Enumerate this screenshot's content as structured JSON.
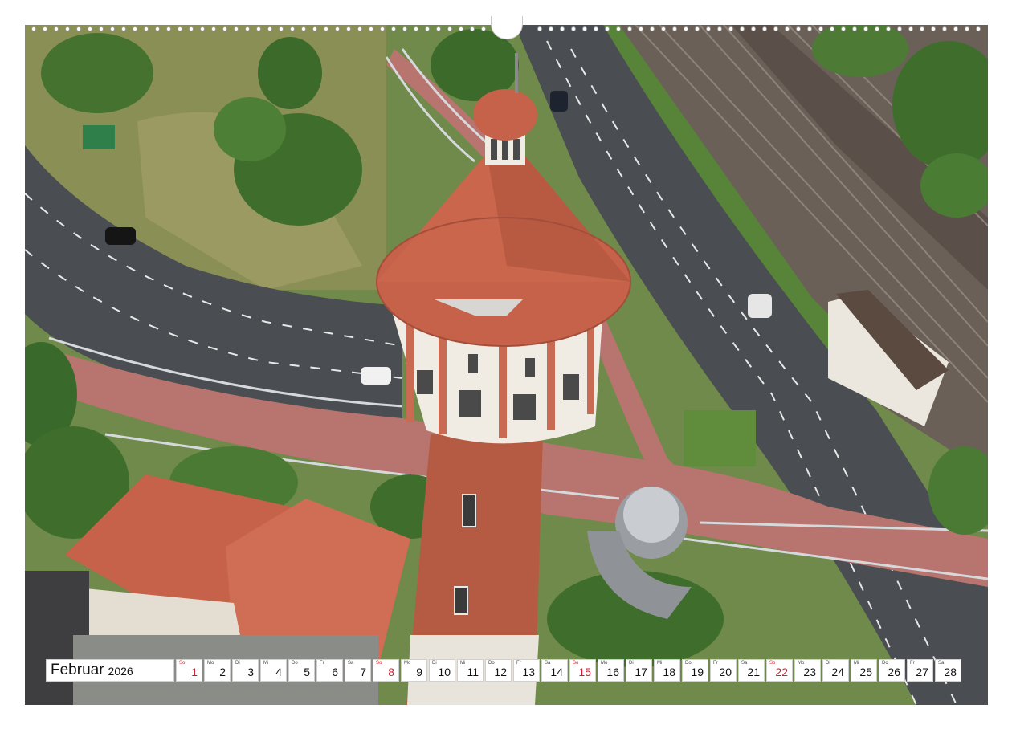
{
  "photo": {
    "subject": "water-tower",
    "colors": {
      "road": "#4a4d51",
      "cycle_path": "#b8746e",
      "roof": "#c6614a",
      "brick": "#b65b43",
      "grass": "#7aa046",
      "trees": "#3e6f2d",
      "track": "#675d55"
    }
  },
  "calendar": {
    "month": "Februar",
    "year": "2026",
    "sunday_color": "#cc1e2c",
    "days": [
      {
        "wd": "So",
        "num": "1",
        "sunday": true
      },
      {
        "wd": "Mo",
        "num": "2",
        "sunday": false
      },
      {
        "wd": "Di",
        "num": "3",
        "sunday": false
      },
      {
        "wd": "Mi",
        "num": "4",
        "sunday": false
      },
      {
        "wd": "Do",
        "num": "5",
        "sunday": false
      },
      {
        "wd": "Fr",
        "num": "6",
        "sunday": false
      },
      {
        "wd": "Sa",
        "num": "7",
        "sunday": false
      },
      {
        "wd": "So",
        "num": "8",
        "sunday": true
      },
      {
        "wd": "Mo",
        "num": "9",
        "sunday": false
      },
      {
        "wd": "Di",
        "num": "10",
        "sunday": false
      },
      {
        "wd": "Mi",
        "num": "11",
        "sunday": false
      },
      {
        "wd": "Do",
        "num": "12",
        "sunday": false
      },
      {
        "wd": "Fr",
        "num": "13",
        "sunday": false
      },
      {
        "wd": "Sa",
        "num": "14",
        "sunday": false
      },
      {
        "wd": "So",
        "num": "15",
        "sunday": true
      },
      {
        "wd": "Mo",
        "num": "16",
        "sunday": false
      },
      {
        "wd": "Di",
        "num": "17",
        "sunday": false
      },
      {
        "wd": "Mi",
        "num": "18",
        "sunday": false
      },
      {
        "wd": "Do",
        "num": "19",
        "sunday": false
      },
      {
        "wd": "Fr",
        "num": "20",
        "sunday": false
      },
      {
        "wd": "Sa",
        "num": "21",
        "sunday": false
      },
      {
        "wd": "So",
        "num": "22",
        "sunday": true
      },
      {
        "wd": "Mo",
        "num": "23",
        "sunday": false
      },
      {
        "wd": "Di",
        "num": "24",
        "sunday": false
      },
      {
        "wd": "Mi",
        "num": "25",
        "sunday": false
      },
      {
        "wd": "Do",
        "num": "26",
        "sunday": false
      },
      {
        "wd": "Fr",
        "num": "27",
        "sunday": false
      },
      {
        "wd": "Sa",
        "num": "28",
        "sunday": false
      }
    ]
  }
}
